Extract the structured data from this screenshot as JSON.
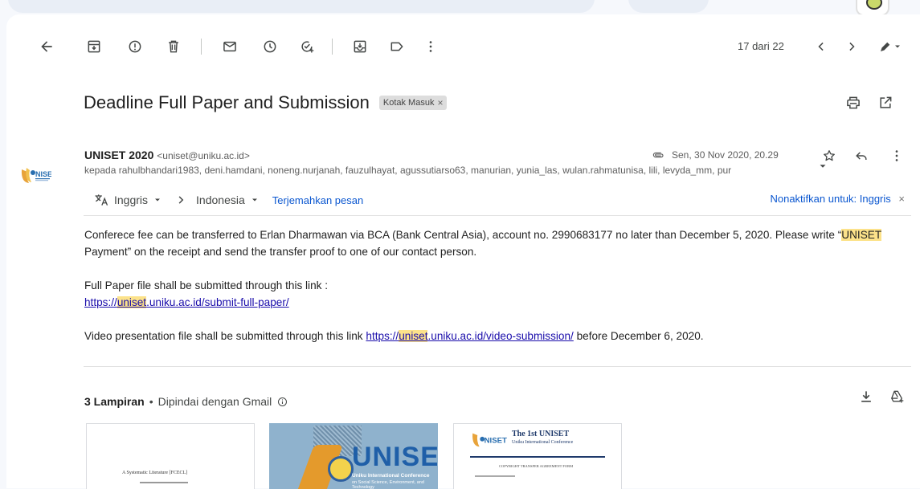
{
  "toolbar": {
    "pager": "17 dari 22"
  },
  "email": {
    "subject": "Deadline Full Paper and Submission",
    "label": "Kotak Masuk",
    "label_close": "×",
    "sender_name": "UNISET 2020",
    "sender_email": "<uniset@uniku.ac.id>",
    "date": "Sen, 30 Nov 2020, 20.29",
    "recipients": "kepada rahulbhandari1983, deni.hamdani, noneng.nurjanah, fauzulhayat, agussutiarso63, manurian, yunia_las, wulan.rahmatunisa, lili, levyda_mm, pur"
  },
  "translate": {
    "from": "Inggris",
    "to": "Indonesia",
    "action": "Terjemahkan pesan",
    "disable": "Nonaktifkan untuk: Inggris",
    "close": "×"
  },
  "body": {
    "p1_a": "Conferece fee can be transferred to Erlan Dharmawan via BCA (Bank Central Asia), account no. 2990683177 no later than  December 5, 2020. Please write “",
    "p1_hl": "UNISET",
    "p1_b": " Payment” on the receipt and send the transfer proof to one of our contact person.",
    "p2_line": "Full Paper file shall be submitted through this link :",
    "p2_link_a": "https://",
    "p2_link_hl": "uniset",
    "p2_link_b": ".uniku.ac.id/submit-full-paper/",
    "p3_a": "Video presentation file shall be submitted through this link ",
    "p3_link_a": "https://",
    "p3_link_hl": "uniset",
    "p3_link_b": ".uniku.ac.id/video-submission/",
    "p3_b": " before December 6, 2020."
  },
  "attachments": {
    "count_label": "3 Lampiran",
    "dot": "•",
    "scan_label": "Dipindai dengan Gmail",
    "items": [
      {
        "title": "A Systematic Literature [FCECL]"
      },
      {
        "title": "UNISET",
        "subtitle": "Uniku International Conference",
        "caption": "on Social Science, Environment, and Technology"
      },
      {
        "title": "The 1st UNISET",
        "subtitle": "Uniku International Conference",
        "caption": "COPYRIGHT TRANSFER AGREEMENT FORM"
      }
    ]
  },
  "colors": {
    "accent": "#0b57d0",
    "highlight": "#fce28a",
    "link": "#1a0dab"
  }
}
